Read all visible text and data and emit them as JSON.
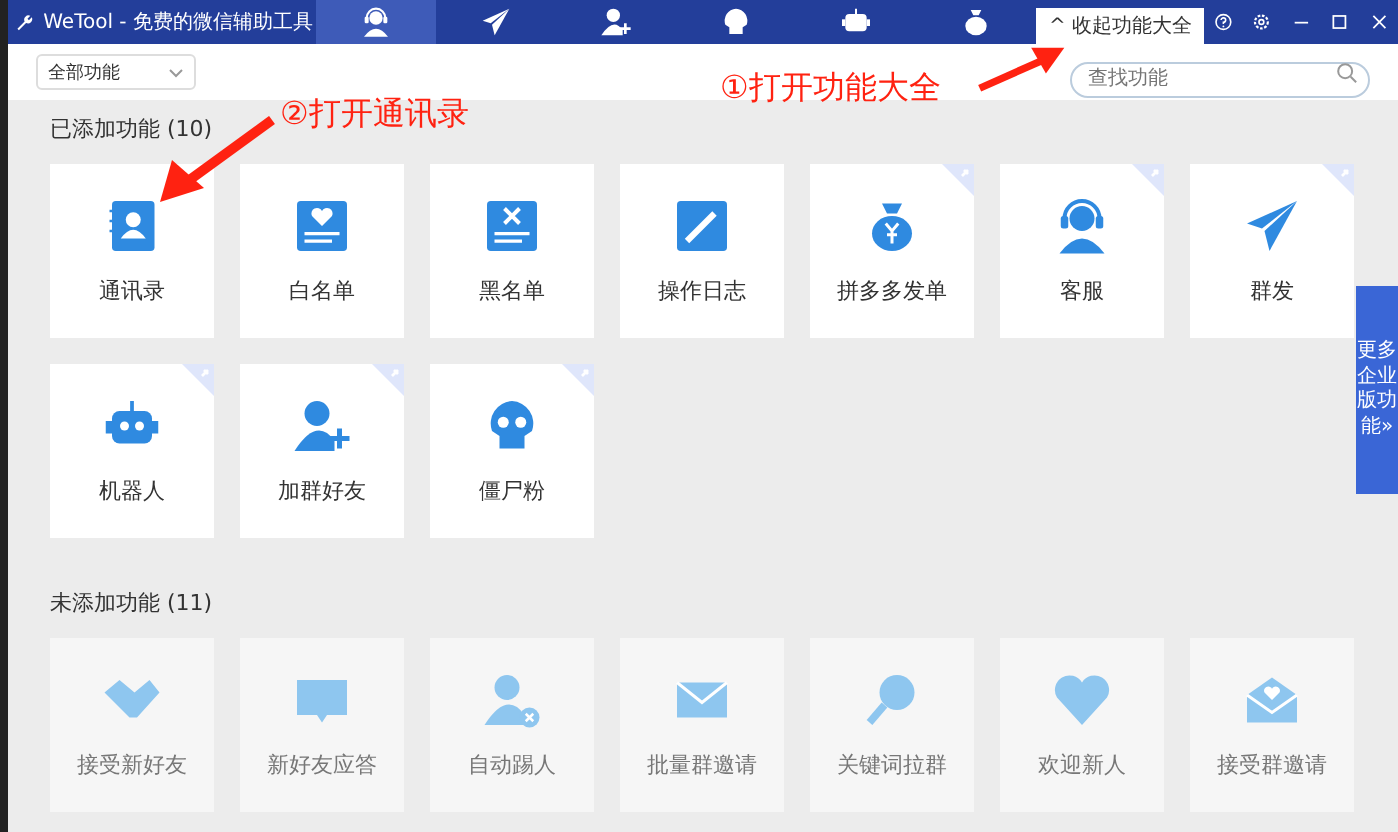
{
  "title_bar": {
    "title": "WeTool - 免费的微信辅助工具",
    "tabs": [
      {
        "selected": true
      },
      {
        "selected": false
      },
      {
        "selected": false
      },
      {
        "selected": false
      },
      {
        "selected": false
      },
      {
        "selected": false
      }
    ],
    "collapse_tab": {
      "caret": "^",
      "label": "收起功能大全"
    }
  },
  "toolbar": {
    "filter": "全部功能",
    "search": {
      "placeholder": "查找功能"
    }
  },
  "sections": [
    {
      "heading": "已添加功能 (10)",
      "added": true,
      "cards": [
        {
          "label": "通讯录",
          "corner_mark": false
        },
        {
          "label": "白名单",
          "corner_mark": false
        },
        {
          "label": "黑名单",
          "corner_mark": false
        },
        {
          "label": "操作日志",
          "corner_mark": false
        },
        {
          "label": "拼多多发单",
          "corner_mark": true
        },
        {
          "label": "客服",
          "corner_mark": true
        },
        {
          "label": "群发",
          "corner_mark": true
        },
        {
          "label": "机器人",
          "corner_mark": true
        },
        {
          "label": "加群好友",
          "corner_mark": true
        },
        {
          "label": "僵尸粉",
          "corner_mark": true
        }
      ]
    },
    {
      "heading": "未添加功能 (11)",
      "added": false,
      "cards": [
        {
          "label": "接受新好友",
          "corner_mark": false
        },
        {
          "label": "新好友应答",
          "corner_mark": false
        },
        {
          "label": "自动踢人",
          "corner_mark": false
        },
        {
          "label": "批量群邀请",
          "corner_mark": false
        },
        {
          "label": "关键词拉群",
          "corner_mark": false
        },
        {
          "label": "欢迎新人",
          "corner_mark": false
        },
        {
          "label": "接受群邀请",
          "corner_mark": false
        }
      ]
    }
  ],
  "side_tab": {
    "label": "更多企业版功能",
    "chevron": "»"
  },
  "annotations": [
    {
      "text": "①打开功能大全"
    },
    {
      "text": "②打开通讯录"
    }
  ]
}
